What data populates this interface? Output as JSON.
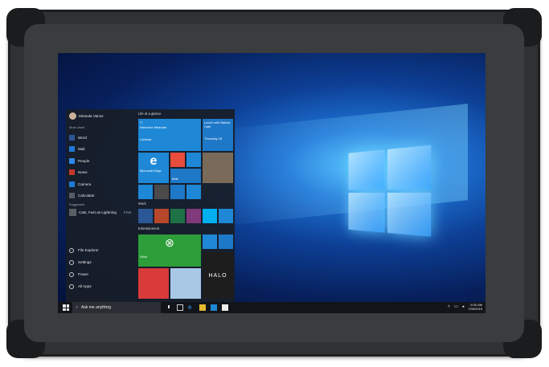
{
  "user": {
    "name": "Miranda Vance"
  },
  "start_menu": {
    "most_used_label": "Most Used",
    "apps": [
      {
        "label": "Word",
        "color": "#2b5797"
      },
      {
        "label": "Mail",
        "color": "#1e7ad6"
      },
      {
        "label": "People",
        "color": "#2d89ef"
      },
      {
        "label": "News",
        "color": "#c0392b"
      },
      {
        "label": "Camera",
        "color": "#1e7ad6"
      },
      {
        "label": "Calculator",
        "color": "#555b63"
      }
    ],
    "suggested_label": "Suggested",
    "suggested_app": "Cats, Fast as Lightning",
    "suggested_badge": "Free",
    "bottom": [
      {
        "label": "File Explorer",
        "icon": "folder-icon"
      },
      {
        "label": "Settings",
        "icon": "gear-icon"
      },
      {
        "label": "Power",
        "icon": "power-icon"
      },
      {
        "label": "All Apps",
        "icon": "apps-icon"
      }
    ]
  },
  "tiles": {
    "group1_label": "Life at a glance",
    "cortana_text": "Welcome Miranda!",
    "cortana_sub": "Cortana",
    "calendar_text": "Lunch with Barbra",
    "calendar_sub": "Cafe",
    "calendar_date": "Thursday 18",
    "edge_label": "Microsoft Edge",
    "mail_label": "Mail",
    "group2_label": "Work",
    "group3_label": "Entertainment",
    "xbox_label": "Xbox",
    "halo_text": "HALO"
  },
  "taskbar": {
    "search_placeholder": "Ask me anything",
    "time": "6:30 AM",
    "date": "7/30/2015"
  }
}
